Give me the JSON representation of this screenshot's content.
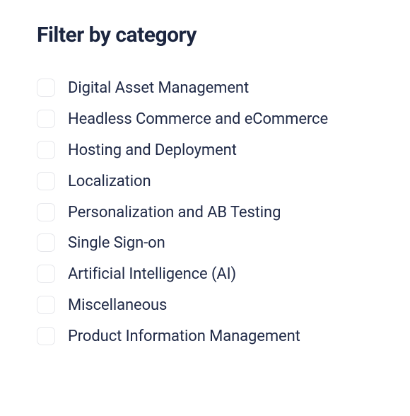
{
  "filter": {
    "title": "Filter by category",
    "items": [
      {
        "label": "Digital Asset Management"
      },
      {
        "label": "Headless Commerce and eCommerce"
      },
      {
        "label": "Hosting and Deployment"
      },
      {
        "label": "Localization"
      },
      {
        "label": "Personalization and AB Testing"
      },
      {
        "label": "Single Sign-on"
      },
      {
        "label": "Artificial Intelligence (AI)"
      },
      {
        "label": "Miscellaneous"
      },
      {
        "label": "Product Information Management"
      }
    ]
  }
}
